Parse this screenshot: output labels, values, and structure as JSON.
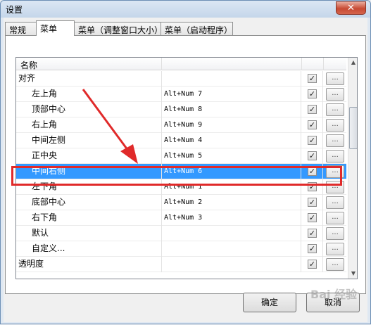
{
  "window": {
    "title": "设置",
    "close_glyph": "✕"
  },
  "tabs": [
    "常规",
    "菜单",
    "菜单（调整窗口大小）",
    "菜单（启动程序）"
  ],
  "list": {
    "columns": [
      "名称",
      "",
      "",
      ""
    ],
    "rows": [
      {
        "name": "对齐",
        "key": "",
        "checked": true,
        "indent": false,
        "selected": false
      },
      {
        "name": "左上角",
        "key": "Alt+Num 7",
        "checked": true,
        "indent": true,
        "selected": false
      },
      {
        "name": "顶部中心",
        "key": "Alt+Num 8",
        "checked": true,
        "indent": true,
        "selected": false
      },
      {
        "name": "右上角",
        "key": "Alt+Num 9",
        "checked": true,
        "indent": true,
        "selected": false
      },
      {
        "name": "中间左侧",
        "key": "Alt+Num 4",
        "checked": true,
        "indent": true,
        "selected": false
      },
      {
        "name": "正中央",
        "key": "Alt+Num 5",
        "checked": true,
        "indent": true,
        "selected": false
      },
      {
        "name": "中间右侧",
        "key": "Alt+Num 6",
        "checked": true,
        "indent": true,
        "selected": true
      },
      {
        "name": "左下角",
        "key": "Alt+Num 1",
        "checked": true,
        "indent": true,
        "selected": false
      },
      {
        "name": "底部中心",
        "key": "Alt+Num 2",
        "checked": true,
        "indent": true,
        "selected": false
      },
      {
        "name": "右下角",
        "key": "Alt+Num 3",
        "checked": true,
        "indent": true,
        "selected": false
      },
      {
        "name": "默认",
        "key": "",
        "checked": true,
        "indent": true,
        "selected": false
      },
      {
        "name": "自定义...",
        "key": "",
        "checked": true,
        "indent": true,
        "selected": false
      },
      {
        "name": "透明度",
        "key": "",
        "checked": true,
        "indent": false,
        "selected": false
      }
    ],
    "ellipsis_label": "...",
    "check_glyph": "✓"
  },
  "buttons": {
    "ok": "确定",
    "cancel": "取消"
  },
  "annotation": {
    "highlight_color": "#e02a2a",
    "arrow_color": "#e02a2a"
  },
  "watermark": "Bai 经验"
}
